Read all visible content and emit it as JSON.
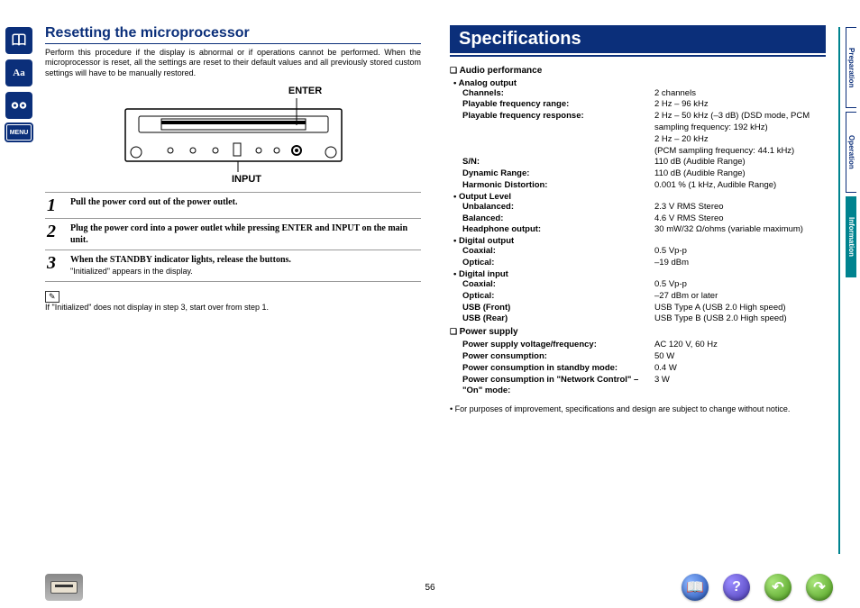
{
  "left_col": {
    "title": "Resetting the microprocessor",
    "intro": "Perform this procedure if the display is abnormal or if operations cannot be performed.\nWhen the microprocessor is reset, all the settings are reset to their default values and all previously stored custom settings will have to be manually restored.",
    "diagram": {
      "top_label": "ENTER",
      "bottom_label": "INPUT"
    },
    "steps": [
      {
        "num": "1",
        "text": "Pull the power cord out of the power outlet."
      },
      {
        "num": "2",
        "text": "Plug the power cord into a power outlet while pressing ENTER and INPUT on the main unit."
      },
      {
        "num": "3",
        "text": "When the STANDBY indicator lights, release the buttons.",
        "note": "\"Initialized\" appears in the display."
      }
    ],
    "footnote": "If \"Initialized\" does not display in step 3, start over from step 1."
  },
  "right_col": {
    "title": "Specifications",
    "sections": [
      {
        "head": "Audio performance",
        "groups": [
          {
            "sub": "Analog output",
            "rows": [
              {
                "k": "Channels:",
                "v": "2 channels"
              },
              {
                "k": "Playable frequency range:",
                "v": "2 Hz – 96 kHz"
              },
              {
                "k": "Playable frequency response:",
                "v": "2 Hz – 50 kHz (–3 dB) (DSD mode, PCM sampling frequency: 192 kHz)\n2 Hz – 20 kHz\n(PCM sampling frequency: 44.1 kHz)"
              },
              {
                "k": "S/N:",
                "v": "110 dB (Audible Range)"
              },
              {
                "k": "Dynamic Range:",
                "v": "110 dB (Audible Range)"
              },
              {
                "k": "Harmonic Distortion:",
                "v": "0.001 % (1 kHz, Audible Range)"
              }
            ]
          },
          {
            "sub": "Output Level",
            "rows": [
              {
                "k": "Unbalanced:",
                "v": "2.3 V RMS Stereo"
              },
              {
                "k": "Balanced:",
                "v": "4.6 V RMS Stereo"
              },
              {
                "k": "Headphone output:",
                "v": "30 mW/32 Ω/ohms (variable maximum)"
              }
            ]
          },
          {
            "sub": "Digital output",
            "rows": [
              {
                "k": "Coaxial:",
                "v": "0.5 Vp-p"
              },
              {
                "k": "Optical:",
                "v": "–19 dBm"
              }
            ]
          },
          {
            "sub": "Digital input",
            "rows": [
              {
                "k": "Coaxial:",
                "v": "0.5 Vp-p"
              },
              {
                "k": "Optical:",
                "v": "–27 dBm or later"
              },
              {
                "k": "USB (Front)",
                "v": "USB Type A (USB 2.0 High speed)"
              },
              {
                "k": "USB (Rear)",
                "v": "USB Type B (USB 2.0 High speed)"
              }
            ]
          }
        ]
      },
      {
        "head": "Power supply",
        "groups": [
          {
            "sub": "",
            "rows": [
              {
                "k": "Power supply voltage/frequency:",
                "v": "AC 120 V, 60 Hz"
              },
              {
                "k": "Power consumption:",
                "v": "50 W"
              },
              {
                "k": "Power consumption in standby mode:",
                "v": "0.4 W"
              },
              {
                "k": "Power consumption in \"Network Control\" – \"On\" mode:",
                "v": "3 W"
              }
            ]
          }
        ]
      }
    ],
    "footnote": "For purposes of improvement, specifications and design are subject to change without notice."
  },
  "side_tabs": [
    {
      "label": "Preparation",
      "active": false
    },
    {
      "label": "Operation",
      "active": false
    },
    {
      "label": "Information",
      "active": true
    }
  ],
  "side_icons": {
    "menu_label": "MENU"
  },
  "page_number": "56",
  "nav": {
    "book": "📖",
    "help": "?",
    "back": "↶",
    "forward": "↷"
  }
}
